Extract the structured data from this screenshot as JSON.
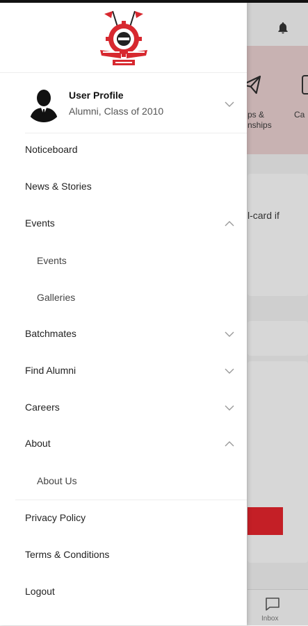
{
  "profile": {
    "name": "User Profile",
    "subtitle": "Alumni, Class of 2010"
  },
  "menu": {
    "noticeboard": "Noticeboard",
    "news": "News & Stories",
    "events": "Events",
    "events_sub": [
      "Events",
      "Galleries"
    ],
    "batchmates": "Batchmates",
    "find_alumni": "Find Alumni",
    "careers": "Careers",
    "about": "About",
    "about_sub": [
      "About Us"
    ],
    "privacy": "Privacy Policy",
    "terms": "Terms & Conditions",
    "logout": "Logout"
  },
  "background": {
    "tile1_line1": "ps &",
    "tile1_line2": "nships",
    "tile2_label": "Ca",
    "card_text": "l-card if",
    "nav_inbox": "Inbox"
  },
  "colors": {
    "brand_red": "#e0242c",
    "pink_banner": "#e4cbcb"
  }
}
